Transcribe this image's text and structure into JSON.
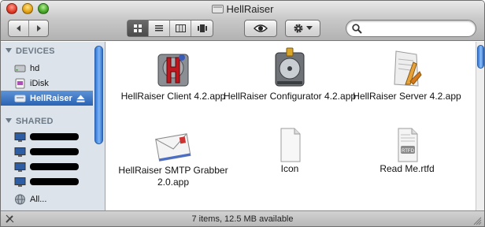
{
  "window": {
    "title": "HellRaiser"
  },
  "toolbar": {
    "back_icon": "chevron-left-icon",
    "forward_icon": "chevron-right-icon",
    "view_modes": [
      "icon-view-icon",
      "list-view-icon",
      "column-view-icon",
      "coverflow-view-icon"
    ],
    "active_view": "icon-view-icon",
    "quicklook_icon": "eye-icon",
    "action_icon": "gear-icon",
    "search_icon": "search-icon",
    "search_value": ""
  },
  "sidebar": {
    "devices_header": "DEVICES",
    "devices": [
      {
        "label": "hd",
        "icon": "hard-drive-icon"
      },
      {
        "label": "iDisk",
        "icon": "idisk-icon"
      },
      {
        "label": "HellRaiser",
        "icon": "disk-image-icon",
        "selected": true,
        "eject_icon": "eject-icon"
      }
    ],
    "shared_header": "SHARED",
    "shared": [
      {
        "label": "",
        "icon": "computer-icon"
      },
      {
        "label": "",
        "icon": "computer-icon"
      },
      {
        "label": "",
        "icon": "computer-icon"
      },
      {
        "label": "",
        "icon": "computer-icon"
      },
      {
        "label": "All...",
        "icon": "network-globe-icon"
      }
    ]
  },
  "files": [
    {
      "name": "HellRaiser Client 4.2.app",
      "icon": "hellraiser-app-icon"
    },
    {
      "name": "HellRaiser Configurator 4.2.app",
      "icon": "disk-utility-app-icon"
    },
    {
      "name": "HellRaiser Server 4.2.app",
      "icon": "script-app-icon"
    },
    {
      "name": "HellRaiser SMTP Grabber 2.0.app",
      "icon": "envelope-app-icon"
    },
    {
      "name": "Icon",
      "icon": "blank-document-icon"
    },
    {
      "name": "Read Me.rtfd",
      "icon": "rtfd-document-icon"
    }
  ],
  "status": {
    "text": "7 items, 12.5 MB available"
  },
  "colors": {
    "selection": "#2a63b3",
    "sidebar_bg": "#dde3ea",
    "section_header": "#6c7987"
  }
}
